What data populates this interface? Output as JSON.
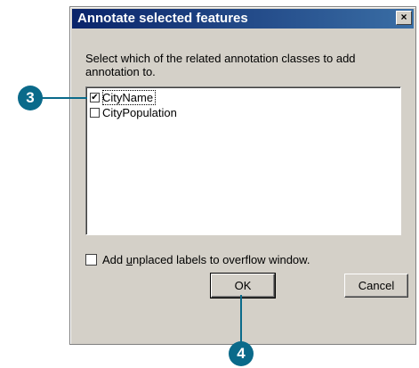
{
  "dialog": {
    "title": "Annotate selected features",
    "close_glyph": "×",
    "prompt": "Select which of the related annotation classes to add annotation to.",
    "classes": [
      {
        "label": "CityName",
        "checked": true
      },
      {
        "label": "CityPopulation",
        "checked": false
      }
    ],
    "overflow_option": {
      "label_before": "Add ",
      "label_accel": "u",
      "label_after": "nplaced labels to overflow window.",
      "checked": false
    },
    "ok_label": "OK",
    "cancel_label": "Cancel"
  },
  "callouts": [
    {
      "number": "3"
    },
    {
      "number": "4"
    }
  ],
  "colors": {
    "callout": "#0a6a8a",
    "titlebar_start": "#0a246a",
    "titlebar_end": "#3a6ea5",
    "dialog_face": "#d4d0c8"
  }
}
